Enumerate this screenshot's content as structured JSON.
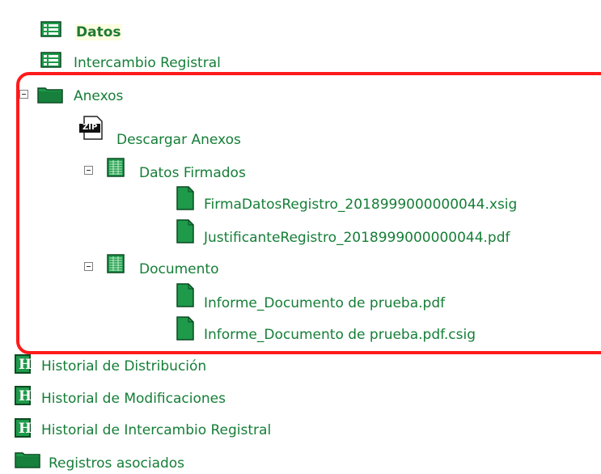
{
  "tree": {
    "datos": "Datos",
    "intercambio": "Intercambio Registral",
    "anexos": "Anexos",
    "descargar": "Descargar Anexos",
    "zip_glyph": "ZIP",
    "datos_firmados": "Datos Firmados",
    "file1": "FirmaDatosRegistro_2018999000000044.xsig",
    "file2": "JustificanteRegistro_2018999000000044.pdf",
    "documento": "Documento",
    "file3": "Informe_Documento de prueba.pdf",
    "file4": "Informe_Documento de prueba.pdf.csig",
    "hist_dist": "Historial de Distribución",
    "hist_mod": "Historial de Modificaciones",
    "hist_inter": "Historial de Intercambio Registral",
    "registros": "Registros asociados",
    "h_glyph": "H"
  },
  "colors": {
    "text": "#157e37",
    "icon_green": "#1e9a4a",
    "highlight": "#ff1a1a"
  },
  "icons": {
    "datos": "form-icon",
    "intercambio": "form-icon",
    "anexos": "folder-icon",
    "descargar": "zip-icon",
    "datos_firmados": "table-icon",
    "documento": "table-icon",
    "files": "document-icon",
    "historial": "h-icon",
    "registros": "folder-icon"
  }
}
